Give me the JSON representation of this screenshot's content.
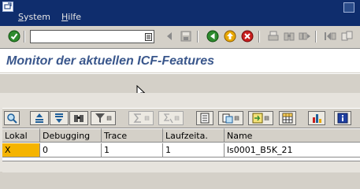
{
  "menu": {
    "items": [
      "System",
      "Hilfe"
    ],
    "underlined_letters": [
      "S",
      "H"
    ]
  },
  "toolbar": {
    "command_value": "",
    "icons": [
      "enter-icon",
      "command-dropdown-icon",
      "back-arrow-icon",
      "save-icon",
      "back-icon",
      "exit-icon",
      "cancel-icon",
      "print-icon",
      "find-icon",
      "find-next-icon",
      "first-page-icon",
      "new-session-icon"
    ]
  },
  "page": {
    "title": "Monitor der aktuellen ICF-Features"
  },
  "alv_toolbar": {
    "icons": [
      "details-icon",
      "sort-ascending-icon",
      "sort-descending-icon",
      "find-icon",
      "filter-icon",
      "sum-icon",
      "subtotal-icon",
      "print-preview-icon",
      "views-icon",
      "export-icon",
      "change-layout-icon",
      "graphic-icon",
      "info-icon"
    ]
  },
  "grid": {
    "columns": [
      "Lokal",
      "Debugging",
      "Trace",
      "Laufzeita.",
      "Name"
    ],
    "rows": [
      [
        "X",
        "0",
        "1",
        "1",
        "ls0001_B5K_21"
      ]
    ]
  },
  "colors": {
    "menubar": "#0f2d6d",
    "title_text": "#3a578c",
    "selected_cell": "#f5b400",
    "chrome": "#d4d0c8"
  }
}
